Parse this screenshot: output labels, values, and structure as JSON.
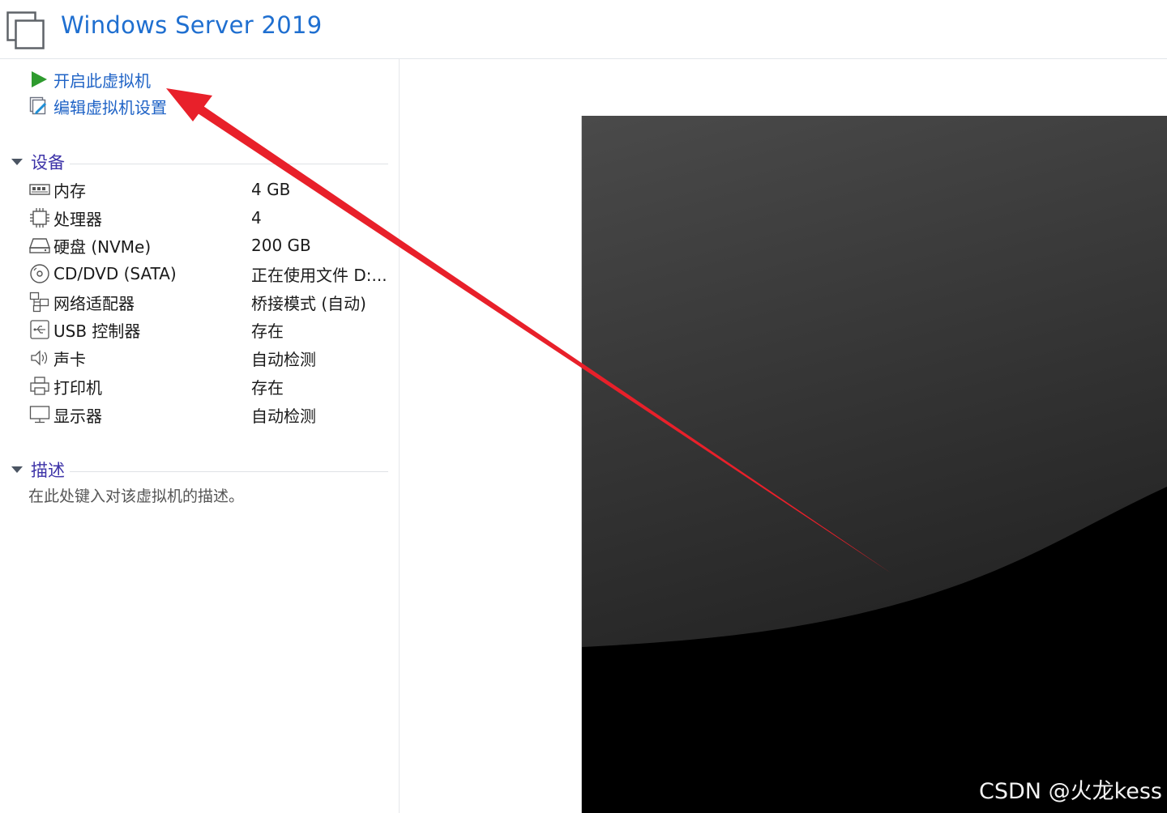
{
  "window": {
    "title": "Windows Server 2019"
  },
  "actions": [
    {
      "label": "开启此虚拟机",
      "icon": "play-icon"
    },
    {
      "label": "编辑虚拟机设置",
      "icon": "edit-settings-icon"
    }
  ],
  "devices": {
    "title": "设备",
    "items": [
      {
        "name": "内存",
        "value": "4 GB",
        "icon": "memory-icon"
      },
      {
        "name": "处理器",
        "value": "4",
        "icon": "processor-icon"
      },
      {
        "name": "硬盘 (NVMe)",
        "value": "200 GB",
        "icon": "hard-disk-icon"
      },
      {
        "name": "CD/DVD (SATA)",
        "value": "正在使用文件 D:...",
        "icon": "cd-dvd-icon"
      },
      {
        "name": "网络适配器",
        "value": "桥接模式 (自动)",
        "icon": "network-adapter-icon"
      },
      {
        "name": "USB 控制器",
        "value": "存在",
        "icon": "usb-icon"
      },
      {
        "name": "声卡",
        "value": "自动检测",
        "icon": "speaker-icon"
      },
      {
        "name": "打印机",
        "value": "存在",
        "icon": "printer-icon"
      },
      {
        "name": "显示器",
        "value": "自动检测",
        "icon": "monitor-icon"
      }
    ]
  },
  "description": {
    "title": "描述",
    "placeholder": "在此处键入对该虚拟机的描述。"
  },
  "watermark": "CSDN @火龙kess",
  "colors": {
    "title": "#1f6fd0",
    "link": "#1f63c6",
    "section": "#3d33a8",
    "play": "#2e9b2e",
    "arrow": "#e8202a"
  }
}
